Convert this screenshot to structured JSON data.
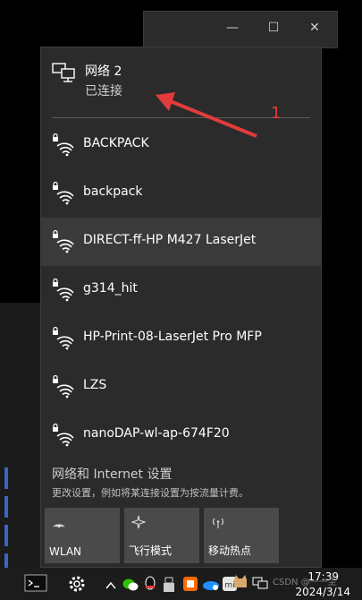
{
  "flyout": {
    "connected": {
      "name": "网络 2",
      "status": "已连接"
    },
    "networks": [
      {
        "ssid": "BACKPACK",
        "secured": true,
        "hover": false
      },
      {
        "ssid": "backpack",
        "secured": true,
        "hover": false
      },
      {
        "ssid": "DIRECT-ff-HP M427 LaserJet",
        "secured": true,
        "hover": true
      },
      {
        "ssid": "g314_hit",
        "secured": true,
        "hover": false
      },
      {
        "ssid": "HP-Print-08-LaserJet Pro MFP",
        "secured": true,
        "hover": false
      },
      {
        "ssid": "LZS",
        "secured": true,
        "hover": false
      },
      {
        "ssid": "nanoDAP-wl-ap-674F20",
        "secured": true,
        "hover": false
      }
    ],
    "settings": {
      "title": "网络和 Internet 设置",
      "description": "更改设置，例如将某连接设置为按流量计费。"
    },
    "quick_actions": [
      {
        "label": "WLAN",
        "icon": "wifi-icon"
      },
      {
        "label": "飞行模式",
        "icon": "airplane-icon"
      },
      {
        "label": "移动热点",
        "icon": "hotspot-icon"
      }
    ]
  },
  "annotation": {
    "label": "1",
    "color": "#e23b3b"
  },
  "background_window": {
    "minimize": "—",
    "maximize": "☐",
    "close": "✕"
  },
  "taskbar": {
    "time": "17:39",
    "date": "2024/3/14",
    "icons": [
      "terminal-icon",
      "settings-gear-icon",
      "chevron-up-icon",
      "wechat-icon",
      "qq-icon",
      "usb-icon",
      "app-icon",
      "cloud-icon",
      "xiaomi-icon",
      "cat-icon",
      "network-icon",
      "volume-icon",
      "ime-icon"
    ]
  },
  "watermark": "CSDN @一一尘",
  "colors": {
    "accent_hover": "#3a3a3a",
    "flyout_bg": "#2b2b2b",
    "tile_bg": "#4a4a4a"
  }
}
